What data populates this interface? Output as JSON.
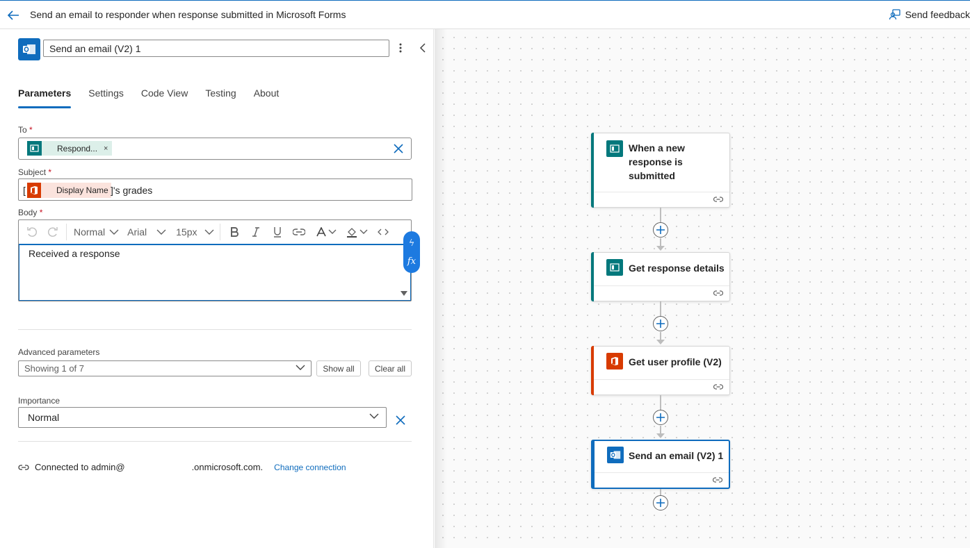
{
  "header": {
    "title": "Send an email to responder when response submitted in Microsoft Forms",
    "feedback_label": "Send feedback"
  },
  "panel": {
    "action_name": "Send an email (V2) 1",
    "tabs": [
      {
        "label": "Parameters",
        "active": true
      },
      {
        "label": "Settings",
        "active": false
      },
      {
        "label": "Code View",
        "active": false
      },
      {
        "label": "Testing",
        "active": false
      },
      {
        "label": "About",
        "active": false
      }
    ],
    "to": {
      "label": "To",
      "required_mark": "*",
      "token_label": "Respond...",
      "token_remove": "×"
    },
    "subject": {
      "label": "Subject",
      "required_mark": "*",
      "prefix": "[",
      "token_label": "Display Name",
      "suffix": "]'s grades"
    },
    "body": {
      "label": "Body",
      "required_mark": "*",
      "toolbar": {
        "style": "Normal",
        "font": "Arial",
        "size": "15px"
      },
      "text": "Received a response",
      "lightning_glyph": "ϟ",
      "fx_label": "fx"
    },
    "advanced": {
      "label": "Advanced parameters",
      "selected": "Showing 1 of 7",
      "show_all": "Show all",
      "clear_all": "Clear all"
    },
    "importance": {
      "label": "Importance",
      "value": "Normal"
    },
    "connection": {
      "prefix": "Connected to admin@",
      "domain": ".onmicrosoft.com.",
      "change_link": "Change connection"
    }
  },
  "flow": {
    "steps": [
      {
        "title": "When a new response is submitted",
        "connector": "microsoft-forms",
        "color": "#03787c",
        "selected": false
      },
      {
        "title": "Get response details",
        "connector": "microsoft-forms",
        "color": "#03787c",
        "selected": false
      },
      {
        "title": "Get user profile (V2)",
        "connector": "office-365-users",
        "color": "#d83b01",
        "selected": false
      },
      {
        "title": "Send an email (V2) 1",
        "connector": "office-365-outlook",
        "color": "#0f6cbd",
        "selected": true
      }
    ]
  },
  "colors": {
    "accent": "#0f6cbd",
    "forms": "#03787c",
    "office": "#d83b01",
    "required": "#c50f1f"
  }
}
